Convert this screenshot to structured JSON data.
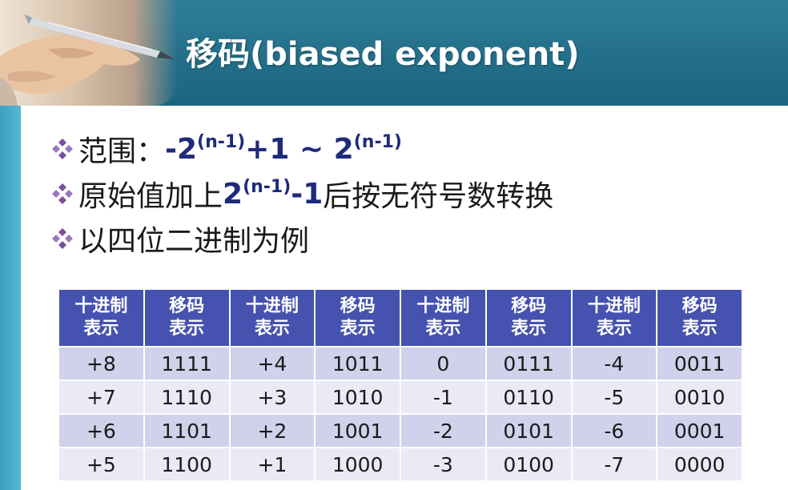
{
  "title": "移码(biased exponent)",
  "bullets": {
    "range": {
      "label": "范围：",
      "part1": "-2",
      "sup1": "(n-1)",
      "part2": "+1 ~ 2",
      "sup2": "(n-1)"
    },
    "rule": {
      "before": "原始值加上",
      "math_base": "2",
      "math_sup": "(n-1)",
      "math_tail": "-1",
      "after": "后按无符号数转换"
    },
    "example": {
      "text": "以四位二进制为例"
    }
  },
  "table": {
    "headers": [
      {
        "line1": "十进制",
        "line2": "表示"
      },
      {
        "line1": "移码",
        "line2": "表示"
      },
      {
        "line1": "十进制",
        "line2": "表示"
      },
      {
        "line1": "移码",
        "line2": "表示"
      },
      {
        "line1": "十进制",
        "line2": "表示"
      },
      {
        "line1": "移码",
        "line2": "表示"
      },
      {
        "line1": "十进制",
        "line2": "表示"
      },
      {
        "line1": "移码",
        "line2": "表示"
      }
    ],
    "rows": [
      [
        "+8",
        "1111",
        "+4",
        "1011",
        "0",
        "0111",
        "-4",
        "0011"
      ],
      [
        "+7",
        "1110",
        "+3",
        "1010",
        "-1",
        "0110",
        "-5",
        "0010"
      ],
      [
        "+6",
        "1101",
        "+2",
        "1001",
        "-2",
        "0101",
        "-6",
        "0001"
      ],
      [
        "+5",
        "1100",
        "+1",
        "1000",
        "-3",
        "0100",
        "-7",
        "0000"
      ]
    ]
  },
  "colors": {
    "header_band": "#236f8a",
    "side_bar": "#4fb0cf",
    "table_header": "#4652b0",
    "row_dark": "#cfd2ea",
    "row_light": "#e9eaf5",
    "math_text": "#1f2a7a",
    "bullet_icon": "#7a4f9e"
  },
  "icons": {
    "bullet": "diamond-cluster-icon",
    "header_image": "hand-holding-pen-photo"
  }
}
